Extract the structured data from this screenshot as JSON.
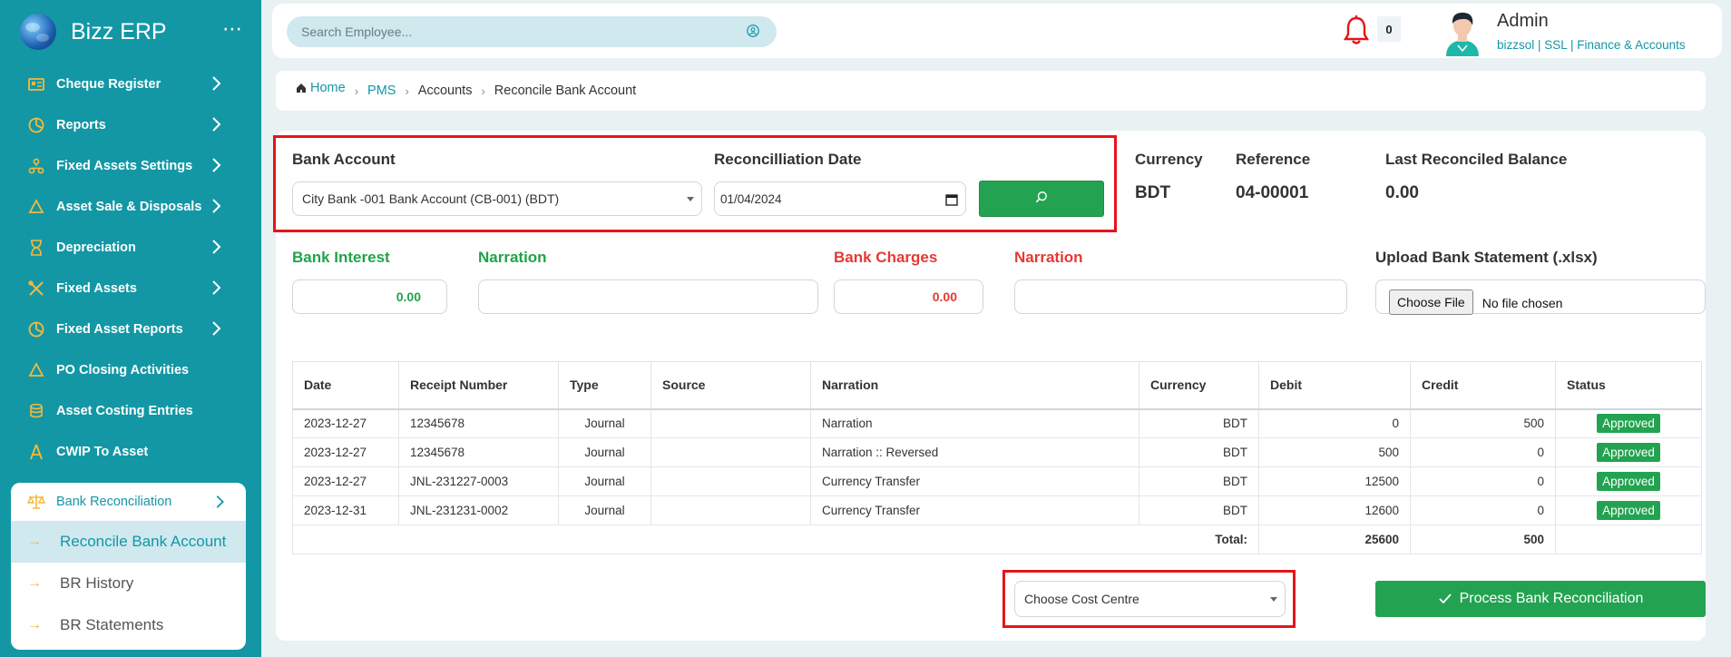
{
  "app": {
    "name": "Bizz ERP"
  },
  "sidebar": {
    "items": [
      {
        "label": "Cheque Register",
        "icon": "cheque-icon"
      },
      {
        "label": "Reports",
        "icon": "pie-chart-icon"
      },
      {
        "label": "Fixed Assets Settings",
        "icon": "hierarchy-icon"
      },
      {
        "label": "Asset Sale & Disposals",
        "icon": "recycle-icon"
      },
      {
        "label": "Depreciation",
        "icon": "hourglass-icon"
      },
      {
        "label": "Fixed Assets",
        "icon": "tools-icon"
      },
      {
        "label": "Fixed Asset Reports",
        "icon": "pie-chart-icon"
      },
      {
        "label": "PO Closing Activities",
        "icon": "recycle-icon"
      },
      {
        "label": "Asset Costing Entries",
        "icon": "coins-icon"
      },
      {
        "label": "CWIP To Asset",
        "icon": "transfer-icon"
      }
    ],
    "submenu": {
      "title": "Bank Reconciliation",
      "items": [
        "Reconcile Bank Account",
        "BR History",
        "BR Statements"
      ]
    }
  },
  "header": {
    "search_placeholder": "Search Employee...",
    "notification_count": "0",
    "user_name": "Admin",
    "user_sub": "bizzsol | SSL  | Finance & Accounts"
  },
  "breadcrumb": {
    "home": "Home",
    "pms": "PMS",
    "accounts": "Accounts",
    "current": "Reconcile Bank Account"
  },
  "form": {
    "bank_account_label": "Bank Account",
    "bank_account_value": "City Bank -001 Bank Account (CB-001) (BDT)",
    "date_label": "Reconcilliation Date",
    "date_value": "01/04/2024",
    "currency_label": "Currency",
    "currency_value": "BDT",
    "reference_label": "Reference",
    "reference_value": "04-00001",
    "last_balance_label": "Last Reconciled Balance",
    "last_balance_value": "0.00",
    "bank_interest_label": "Bank Interest",
    "bank_interest_value": "0.00",
    "narration_label": "Narration",
    "bank_charges_label": "Bank Charges",
    "bank_charges_value": "0.00",
    "upload_label": "Upload Bank Statement (.xlsx)",
    "choose_file": "Choose File",
    "no_file": "No file chosen"
  },
  "table": {
    "headers": [
      "Date",
      "Receipt Number",
      "Type",
      "Source",
      "Narration",
      "Currency",
      "Debit",
      "Credit",
      "Status"
    ],
    "rows": [
      [
        "2023-12-27",
        "12345678",
        "Journal",
        "",
        "Narration",
        "BDT",
        "0",
        "500",
        "Approved"
      ],
      [
        "2023-12-27",
        "12345678",
        "Journal",
        "",
        "Narration :: Reversed",
        "BDT",
        "500",
        "0",
        "Approved"
      ],
      [
        "2023-12-27",
        "JNL-231227-0003",
        "Journal",
        "",
        "Currency Transfer",
        "BDT",
        "12500",
        "0",
        "Approved"
      ],
      [
        "2023-12-31",
        "JNL-231231-0002",
        "Journal",
        "",
        "Currency Transfer",
        "BDT",
        "12600",
        "0",
        "Approved"
      ]
    ],
    "total_label": "Total:",
    "total_debit": "25600",
    "total_credit": "500"
  },
  "footer": {
    "cost_centre_placeholder": "Choose Cost Centre",
    "process_label": "Process Bank Reconciliation"
  },
  "colors": {
    "sidebar": "#1397a5",
    "accent_green": "#23a351",
    "highlight_red": "#e5141b",
    "icon_orange": "#f6b93b"
  }
}
